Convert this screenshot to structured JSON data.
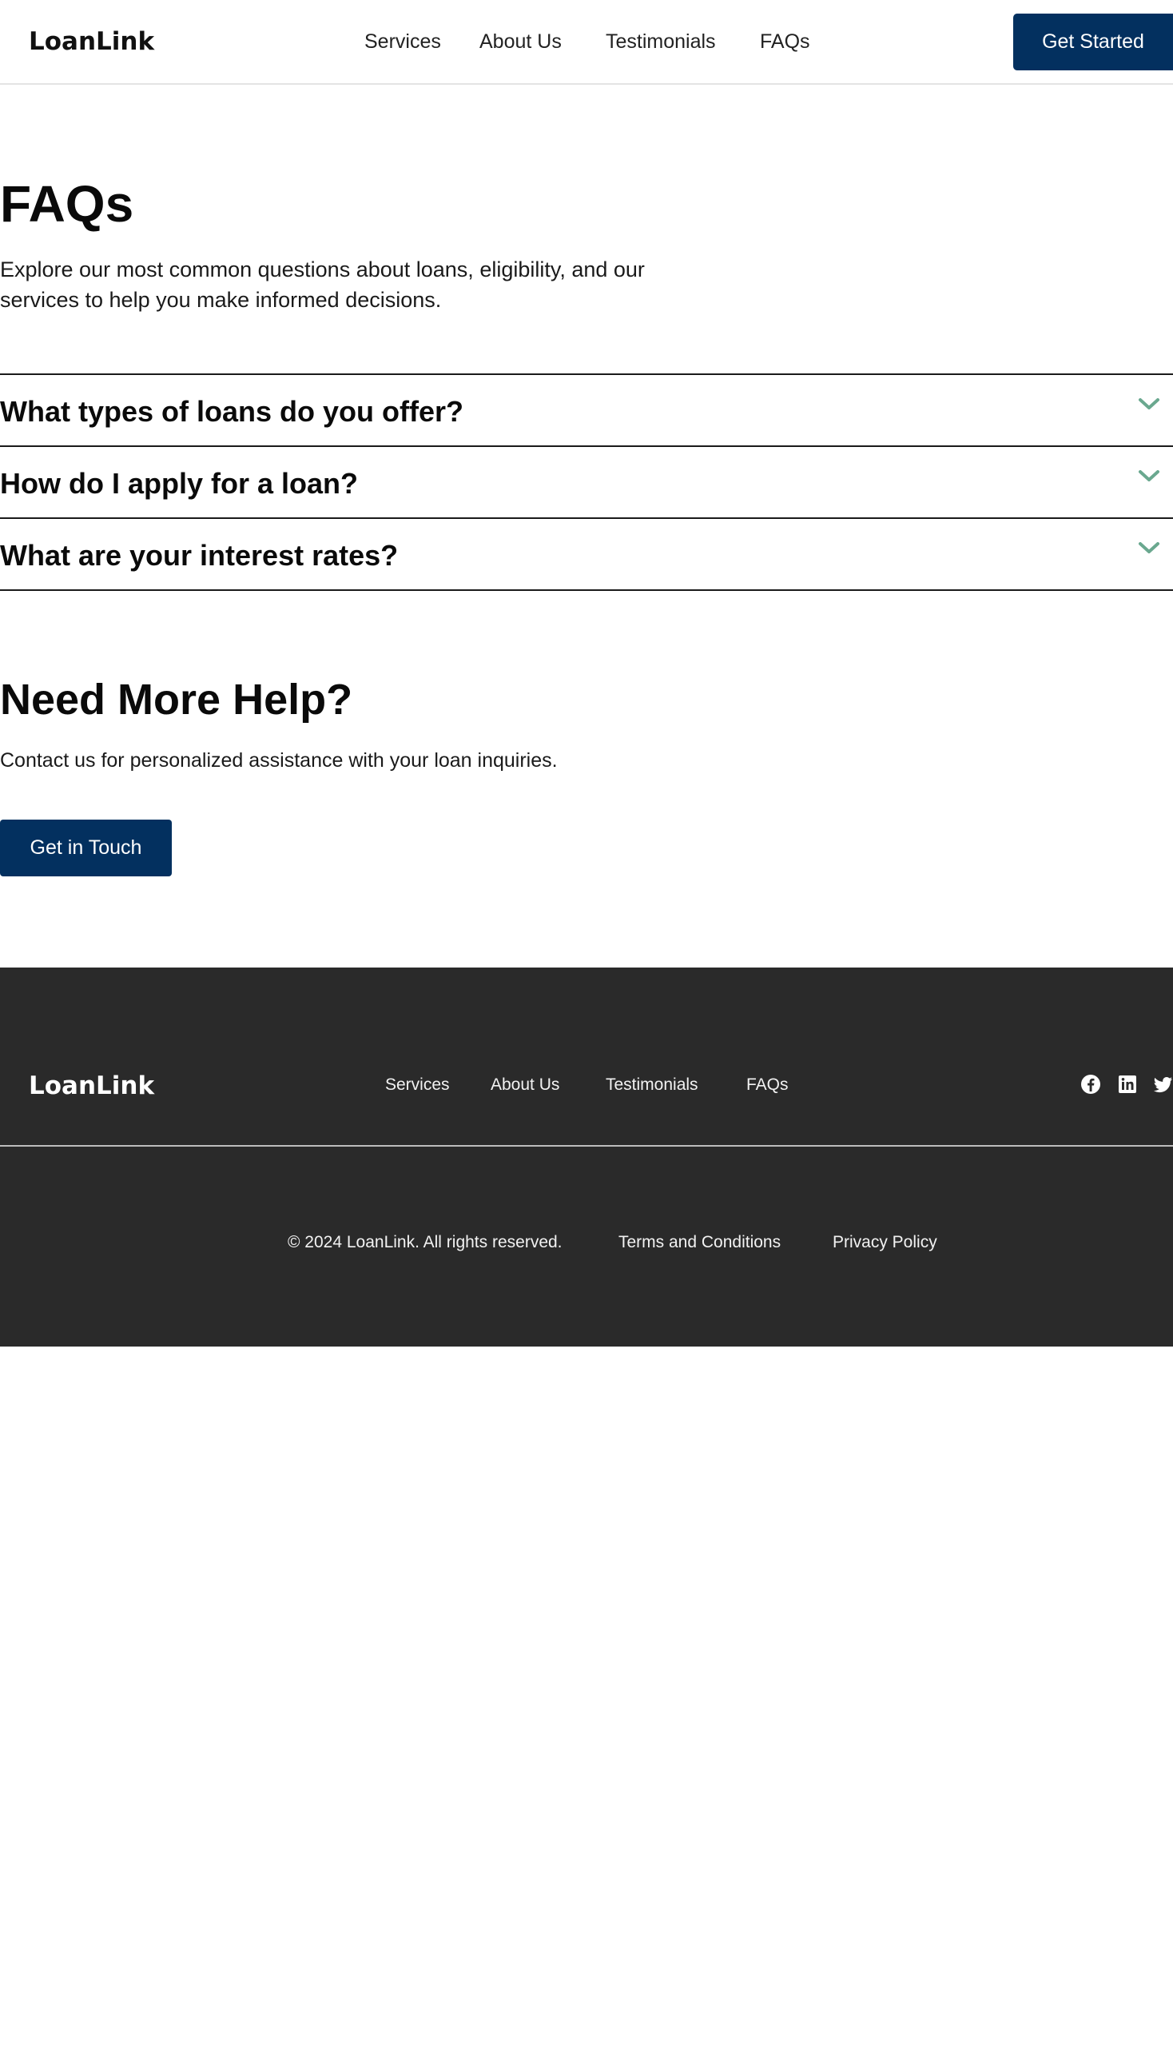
{
  "header": {
    "logo_text": "LoanLink",
    "nav": [
      "Services",
      "About Us",
      "Testimonials",
      "FAQs"
    ],
    "cta_label": "Get Started"
  },
  "faq": {
    "title": "FAQs",
    "intro": "Explore our most common questions about loans, eligibility, and our services to help you make informed decisions.",
    "items": [
      "What types of loans do you offer?",
      "How do I apply for a loan?",
      "What are your interest rates?"
    ],
    "chevron_icon": "chevron-down-icon",
    "chevron_color": "#6aa88f"
  },
  "help": {
    "title": "Need More Help?",
    "text": "Contact us for personalized assistance with your loan inquiries.",
    "button_label": "Get in Touch"
  },
  "footer": {
    "logo_text": "LoanLink",
    "nav": [
      "Services",
      "About Us",
      "Testimonials",
      "FAQs"
    ],
    "social_icons": [
      "facebook-icon",
      "linkedin-icon",
      "twitter-icon"
    ],
    "copyright": "© 2024 LoanLink. All rights reserved.",
    "terms_label": "Terms and Conditions",
    "privacy_label": "Privacy Policy"
  },
  "colors": {
    "primary": "#03305f",
    "footer_bg": "#2a2a2a",
    "accent": "#6aa88f"
  }
}
